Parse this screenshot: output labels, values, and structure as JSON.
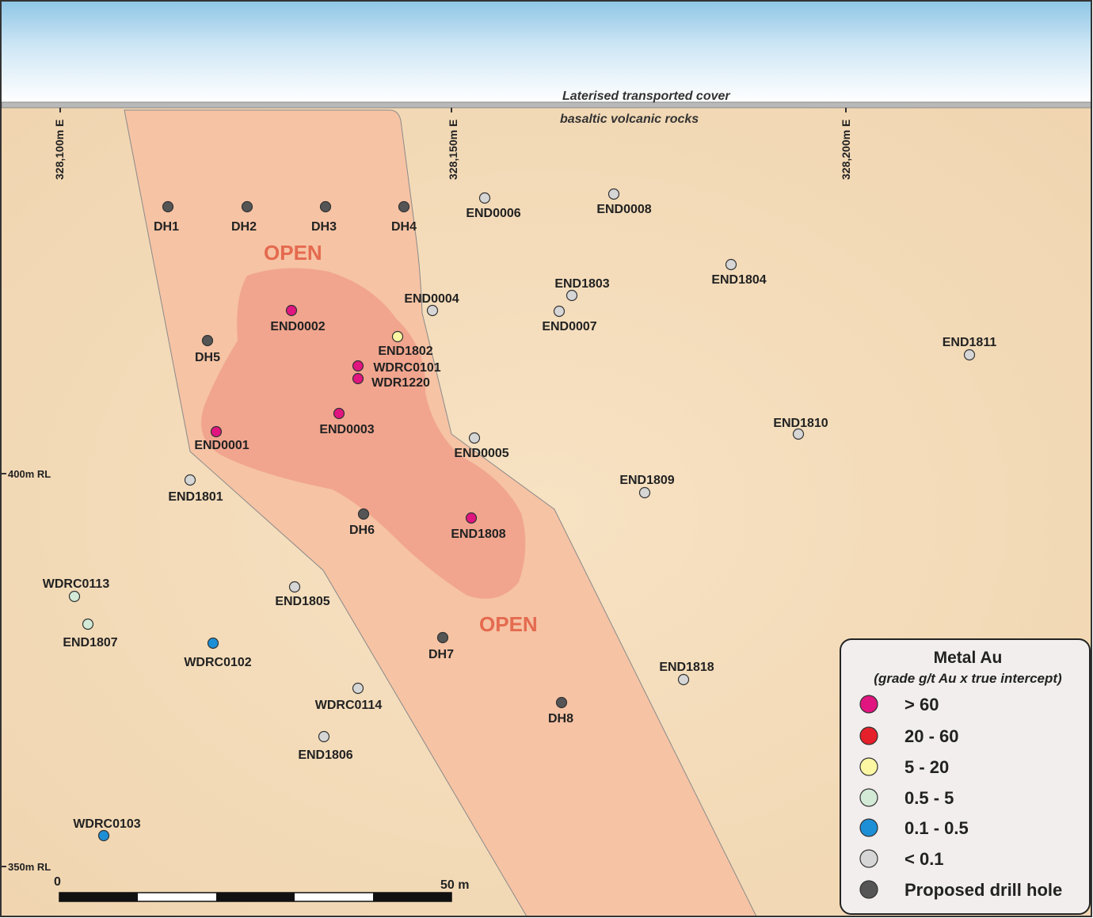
{
  "layers": {
    "cover": "Laterised transported cover",
    "bedrock": "basaltic volcanic rocks"
  },
  "eastings": [
    "328,100m E",
    "328,150m E",
    "328,200m E"
  ],
  "elevations": [
    "400m RL",
    "350m RL"
  ],
  "zone_labels": [
    "OPEN",
    "OPEN"
  ],
  "scale_bar": {
    "start": "0",
    "end": "50 m"
  },
  "legend": {
    "title": "Metal Au",
    "subtitle": "(grade g/t Au x true intercept)",
    "items": [
      {
        "label": "> 60",
        "color": "#e0157f"
      },
      {
        "label": "20 - 60",
        "color": "#e5202a"
      },
      {
        "label": "5 - 20",
        "color": "#fbf7a3"
      },
      {
        "label": "0.5 - 5",
        "color": "#d3ead6"
      },
      {
        "label": "0.1 - 0.5",
        "color": "#1d8fd6"
      },
      {
        "label": "< 0.1",
        "color": "#d6d6d6"
      },
      {
        "label": "Proposed drill hole",
        "color": "#555555"
      }
    ]
  },
  "drill_holes": [
    {
      "name": "DH1",
      "class": "proposed"
    },
    {
      "name": "DH2",
      "class": "proposed"
    },
    {
      "name": "DH3",
      "class": "proposed"
    },
    {
      "name": "DH4",
      "class": "proposed"
    },
    {
      "name": "END0006",
      "class": "<0.1"
    },
    {
      "name": "END0008",
      "class": "<0.1"
    },
    {
      "name": "END1804",
      "class": "<0.1"
    },
    {
      "name": "END1803",
      "class": "<0.1"
    },
    {
      "name": "END0004",
      "class": "<0.1"
    },
    {
      "name": "END0007",
      "class": "<0.1"
    },
    {
      "name": "END0002",
      "class": ">60"
    },
    {
      "name": "DH5",
      "class": "proposed"
    },
    {
      "name": "END1802",
      "class": "5-20"
    },
    {
      "name": "WDRC0101",
      "class": ">60"
    },
    {
      "name": "WDR1220",
      "class": ">60"
    },
    {
      "name": "END1811",
      "class": "<0.1"
    },
    {
      "name": "END0003",
      "class": ">60"
    },
    {
      "name": "END0001",
      "class": ">60"
    },
    {
      "name": "END0005",
      "class": "<0.1"
    },
    {
      "name": "END1810",
      "class": "<0.1"
    },
    {
      "name": "END1801",
      "class": "<0.1"
    },
    {
      "name": "END1809",
      "class": "<0.1"
    },
    {
      "name": "DH6",
      "class": "proposed"
    },
    {
      "name": "END1808",
      "class": ">60"
    },
    {
      "name": "WDRC0113",
      "class": "0.5-5"
    },
    {
      "name": "END1805",
      "class": "<0.1"
    },
    {
      "name": "END1807",
      "class": "0.5-5"
    },
    {
      "name": "WDRC0102",
      "class": "0.1-0.5"
    },
    {
      "name": "DH7",
      "class": "proposed"
    },
    {
      "name": "END1818",
      "class": "<0.1"
    },
    {
      "name": "WDRC0114",
      "class": "<0.1"
    },
    {
      "name": "DH8",
      "class": "proposed"
    },
    {
      "name": "END1806",
      "class": "<0.1"
    },
    {
      "name": "WDRC0103",
      "class": "0.1-0.5"
    }
  ]
}
